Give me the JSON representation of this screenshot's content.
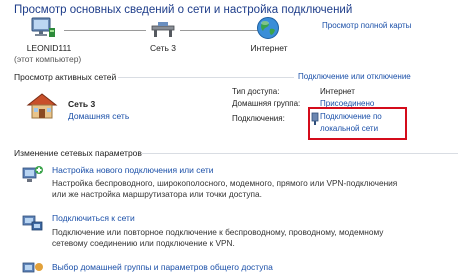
{
  "header": {
    "title": "Просмотр основных сведений о сети и настройка подключений",
    "full_map_link": "Просмотр полной карты"
  },
  "network_map": {
    "computer_label": "LEONID111",
    "computer_sublabel": "(этот компьютер)",
    "network_label": "Сеть  3",
    "internet_label": "Интернет"
  },
  "active_networks": {
    "heading": "Просмотр активных сетей",
    "connect_link": "Подключение или отключение",
    "network_name": "Сеть  3",
    "network_type_link": "Домашняя сеть",
    "access_type_label": "Тип доступа:",
    "access_type_value": "Интернет",
    "homegroup_label": "Домашняя группа:",
    "homegroup_value": "Присоединено",
    "connections_label": "Подключения:",
    "connection_link_line1": "Подключение по",
    "connection_link_line2": "локальной сети"
  },
  "change_settings": {
    "heading": "Изменение сетевых параметров",
    "items": [
      {
        "title": "Настройка нового подключения или сети",
        "desc_line1": "Настройка беспроводного, широкополосного, модемного, прямого или VPN-подключения",
        "desc_line2": "или же настройка маршрутизатора или точки доступа."
      },
      {
        "title": "Подключиться к сети",
        "desc_line1": "Подключение или повторное подключение к беспроводному, проводному, модемному",
        "desc_line2": "сетевому соединению или подключение к VPN."
      },
      {
        "title": "Выбор домашней группы и параметров общего доступа",
        "desc_line1": "",
        "desc_line2": ""
      }
    ]
  },
  "colors": {
    "link": "#1a4fa8",
    "highlight": "#d40c1b"
  }
}
